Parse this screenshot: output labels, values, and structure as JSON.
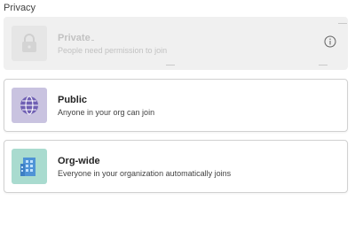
{
  "privacy": {
    "section_label": "Privacy",
    "options": [
      {
        "title": "Private",
        "description": "People need permission to join",
        "state": "disabled",
        "icon": "lock-icon",
        "tile_color": "#e6e6e6"
      },
      {
        "title": "Public",
        "description": "Anyone in your org can join",
        "state": "enabled",
        "icon": "globe-icon",
        "tile_color": "#c9c3e0"
      },
      {
        "title": "Org-wide",
        "description": "Everyone in your organization automatically joins",
        "state": "enabled",
        "icon": "building-icon",
        "tile_color": "#a9dbcf"
      }
    ]
  }
}
